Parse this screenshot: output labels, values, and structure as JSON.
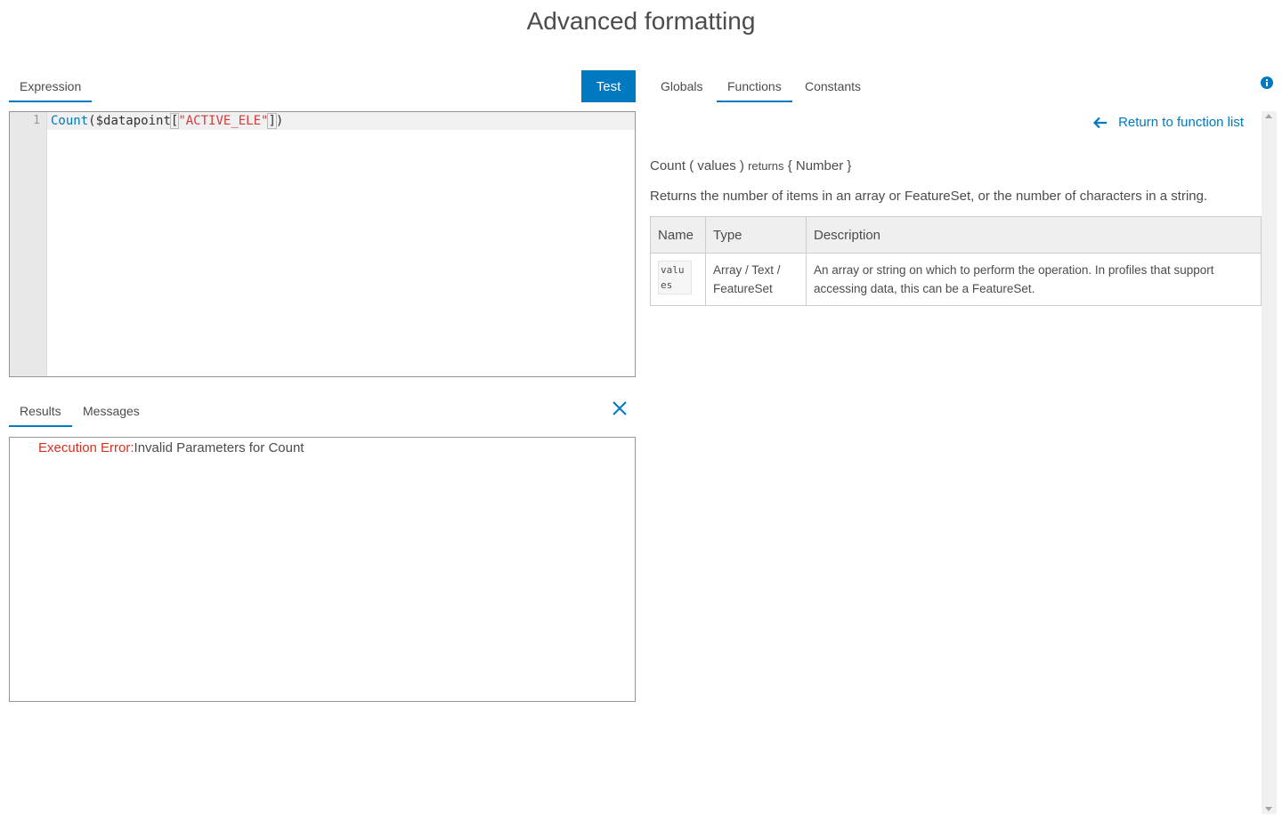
{
  "page": {
    "title": "Advanced formatting"
  },
  "left_tabs": [
    {
      "label": "Expression",
      "active": true
    }
  ],
  "toolbar": {
    "test_label": "Test"
  },
  "editor": {
    "line_number": "1",
    "code": {
      "fn": "Count",
      "p1": "($datapoint",
      "b1": "[",
      "str": "\"ACTIVE_ELE\"",
      "b2": "]",
      "p2": ")"
    }
  },
  "result_tabs": [
    {
      "label": "Results",
      "active": true
    },
    {
      "label": "Messages",
      "active": false
    }
  ],
  "results": {
    "error_label": "Execution Error:",
    "error_message": "Invalid Parameters for Count"
  },
  "right_tabs": [
    {
      "label": "Globals",
      "active": false
    },
    {
      "label": "Functions",
      "active": true
    },
    {
      "label": "Constants",
      "active": false
    }
  ],
  "function_detail": {
    "return_link": "Return to function list",
    "signature_fn": "Count ( values )",
    "signature_returns": "returns",
    "signature_type": "{ Number }",
    "description": "Returns the number of items in an array or FeatureSet, or the number of characters in a string.",
    "table": {
      "headers": [
        "Name",
        "Type",
        "Description"
      ],
      "rows": [
        {
          "name": "values",
          "type": "Array / Text / FeatureSet",
          "description": "An array or string on which to perform the operation. In profiles that support accessing data, this can be a FeatureSet."
        }
      ]
    }
  },
  "colors": {
    "accent": "#0079c1",
    "error": "#d83020",
    "string": "#d63b3b"
  },
  "icons": {
    "close": "close-icon",
    "info": "info-icon",
    "back": "arrow-left-icon"
  }
}
